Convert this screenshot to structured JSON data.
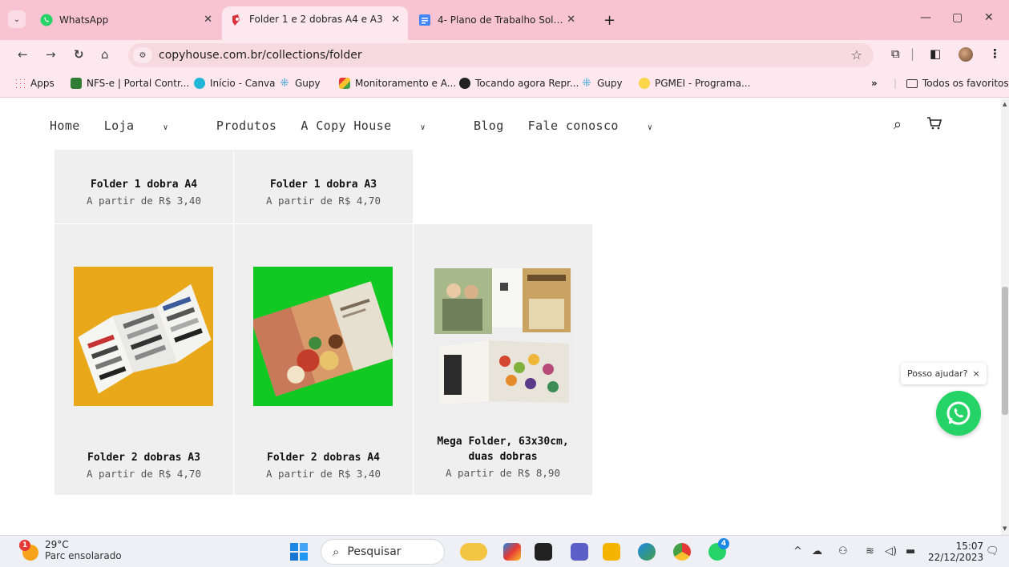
{
  "browser": {
    "tabs": [
      {
        "title": "WhatsApp",
        "active": false
      },
      {
        "title": "Folder 1 e 2 dobras A4 e A3",
        "active": true
      },
      {
        "title": "4- Plano de Trabalho Solano Tri",
        "active": false
      }
    ],
    "url": "copyhouse.com.br/collections/folder",
    "bookmarks": [
      "Apps",
      "NFS-e | Portal Contr...",
      "Início - Canva",
      "Gupy",
      "Monitoramento e A...",
      "Tocando agora Repr...",
      "Gupy",
      "PGMEI - Programa..."
    ],
    "all_bookmarks_label": "Todos os favoritos"
  },
  "site": {
    "nav": [
      {
        "label": "Home",
        "dropdown": false
      },
      {
        "label": "Loja",
        "dropdown": true
      },
      {
        "label": "Produtos",
        "dropdown": false
      },
      {
        "label": "A Copy House",
        "dropdown": true
      },
      {
        "label": "Blog",
        "dropdown": false
      },
      {
        "label": "Fale conosco",
        "dropdown": true
      }
    ],
    "products": [
      {
        "name": "Folder 1 dobra A4",
        "price": "A partir de R$ 3,40"
      },
      {
        "name": "Folder 1 dobra A3",
        "price": "A partir de R$ 4,70"
      },
      {
        "name": "Folder 2 dobras A3",
        "price": "A partir de R$ 4,70"
      },
      {
        "name": "Folder 2 dobras A4",
        "price": "A partir de R$ 3,40"
      },
      {
        "name": "Mega Folder, 63x30cm, duas dobras",
        "price": "A partir de R$ 8,90"
      }
    ],
    "help_bubble": "Posso ajudar?",
    "help_close": "×"
  },
  "taskbar": {
    "temperature": "29°C",
    "weather": "Parc ensolarado",
    "weather_badge": "1",
    "search_placeholder": "Pesquisar",
    "whatsapp_badge": "4",
    "time": "15:07",
    "date": "22/12/2023"
  },
  "colors": {
    "chrome_pink": "#f8c4d3",
    "card_gray": "#efefef",
    "whatsapp_green": "#25d366",
    "product_yellow_bg": "#e8a81a",
    "product_green_bg": "#12c924"
  }
}
